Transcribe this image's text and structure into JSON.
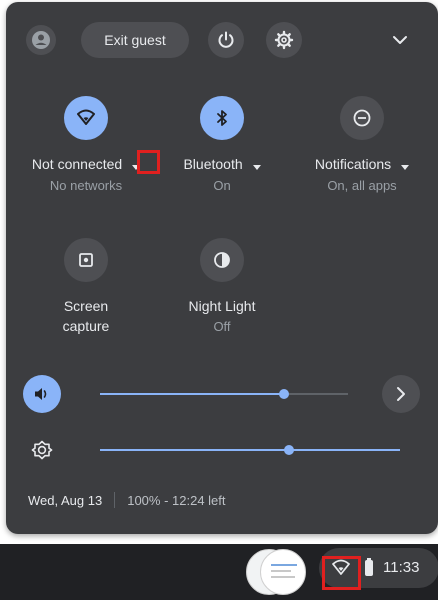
{
  "top_bar": {
    "exit_guest_label": "Exit guest"
  },
  "features": {
    "network": {
      "label": "Not connected",
      "sub": "No networks",
      "icon": "wifi-icon"
    },
    "bluetooth": {
      "label": "Bluetooth",
      "sub": "On",
      "icon": "bluetooth-icon"
    },
    "notifications": {
      "label": "Notifications",
      "sub": "On, all apps",
      "icon": "do-not-disturb-icon"
    },
    "screen_capture": {
      "label": "Screen",
      "label2": "capture",
      "icon": "screen-capture-icon"
    },
    "night_light": {
      "label": "Night Light",
      "sub": "Off",
      "icon": "night-light-icon"
    }
  },
  "sliders": {
    "volume_level": 0.74,
    "brightness_level": 0.63
  },
  "status": {
    "date": "Wed, Aug 13",
    "battery": "100% - 12:24 left"
  },
  "shelf": {
    "time": "11:33"
  },
  "colors": {
    "panel_bg": "#3c3d40",
    "accent": "#8ab4f8",
    "highlight_box": "#e0201f"
  }
}
